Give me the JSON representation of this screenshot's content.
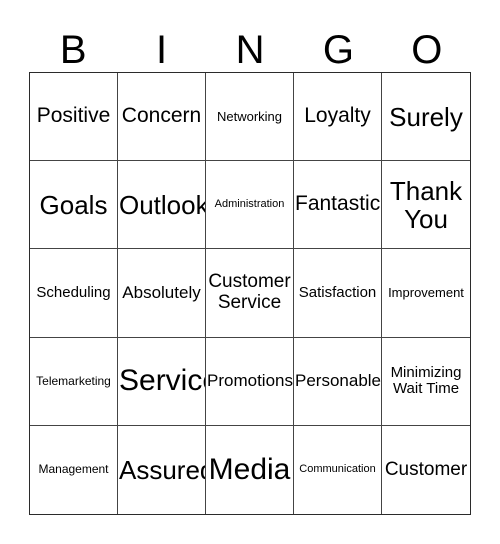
{
  "card": {
    "title_letters": [
      "B",
      "I",
      "N",
      "G",
      "O"
    ],
    "columns": 5,
    "rows": 5,
    "grid_line_color": "#444444",
    "border_color": "#2b2b2b",
    "background_color": "#ffffff",
    "text_color": "#000000"
  },
  "cells": [
    [
      {
        "text": "Positive",
        "size": "fs-xl"
      },
      {
        "text": "Concern",
        "size": "fs-xl"
      },
      {
        "text": "Networking",
        "size": "fs-sm"
      },
      {
        "text": "Loyalty",
        "size": "fs-xl"
      },
      {
        "text": "Surely",
        "size": "fs-xxl"
      }
    ],
    [
      {
        "text": "Goals",
        "size": "fs-xxl"
      },
      {
        "text": "Outlook",
        "size": "fs-xxl"
      },
      {
        "text": "Administration",
        "size": "fs-xs"
      },
      {
        "text": "Fantastic",
        "size": "fs-xl"
      },
      {
        "text": "Thank\nYou",
        "size": "fs-xxl"
      }
    ],
    [
      {
        "text": "Scheduling",
        "size": "fs-m"
      },
      {
        "text": "Absolutely",
        "size": "fs-ml"
      },
      {
        "text": "Customer\nService",
        "size": "fs-l"
      },
      {
        "text": "Satisfaction",
        "size": "fs-m"
      },
      {
        "text": "Improvement",
        "size": "fs-sm"
      }
    ],
    [
      {
        "text": "Telemarketing",
        "size": "fs-s"
      },
      {
        "text": "Service",
        "size": "fs-huge"
      },
      {
        "text": "Promotions",
        "size": "fs-ml"
      },
      {
        "text": "Personable",
        "size": "fs-ml"
      },
      {
        "text": "Minimizing\nWait Time",
        "size": "fs-m"
      }
    ],
    [
      {
        "text": "Management",
        "size": "fs-s"
      },
      {
        "text": "Assured",
        "size": "fs-xxl"
      },
      {
        "text": "Media",
        "size": "fs-huge"
      },
      {
        "text": "Communication",
        "size": "fs-xs"
      },
      {
        "text": "Customer",
        "size": "fs-l"
      }
    ]
  ]
}
